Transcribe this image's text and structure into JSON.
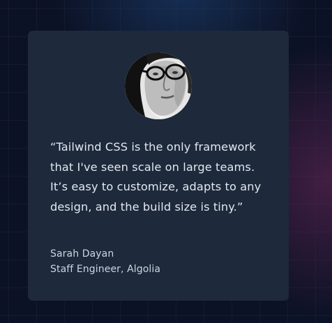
{
  "testimonial": {
    "quote": "“Tailwind CSS is the only framework that I've seen scale on large teams. It’s easy to customize, adapts to any design, and the build size is tiny.”",
    "author_name": "Sarah Dayan",
    "author_role": "Staff Engineer, Algolia",
    "avatar_icon": "person-photo"
  },
  "colors": {
    "card_background": "#1e293b",
    "quote_text": "#e2e8f0",
    "author_text": "#cbd5e1",
    "page_background": "#0c1226"
  }
}
